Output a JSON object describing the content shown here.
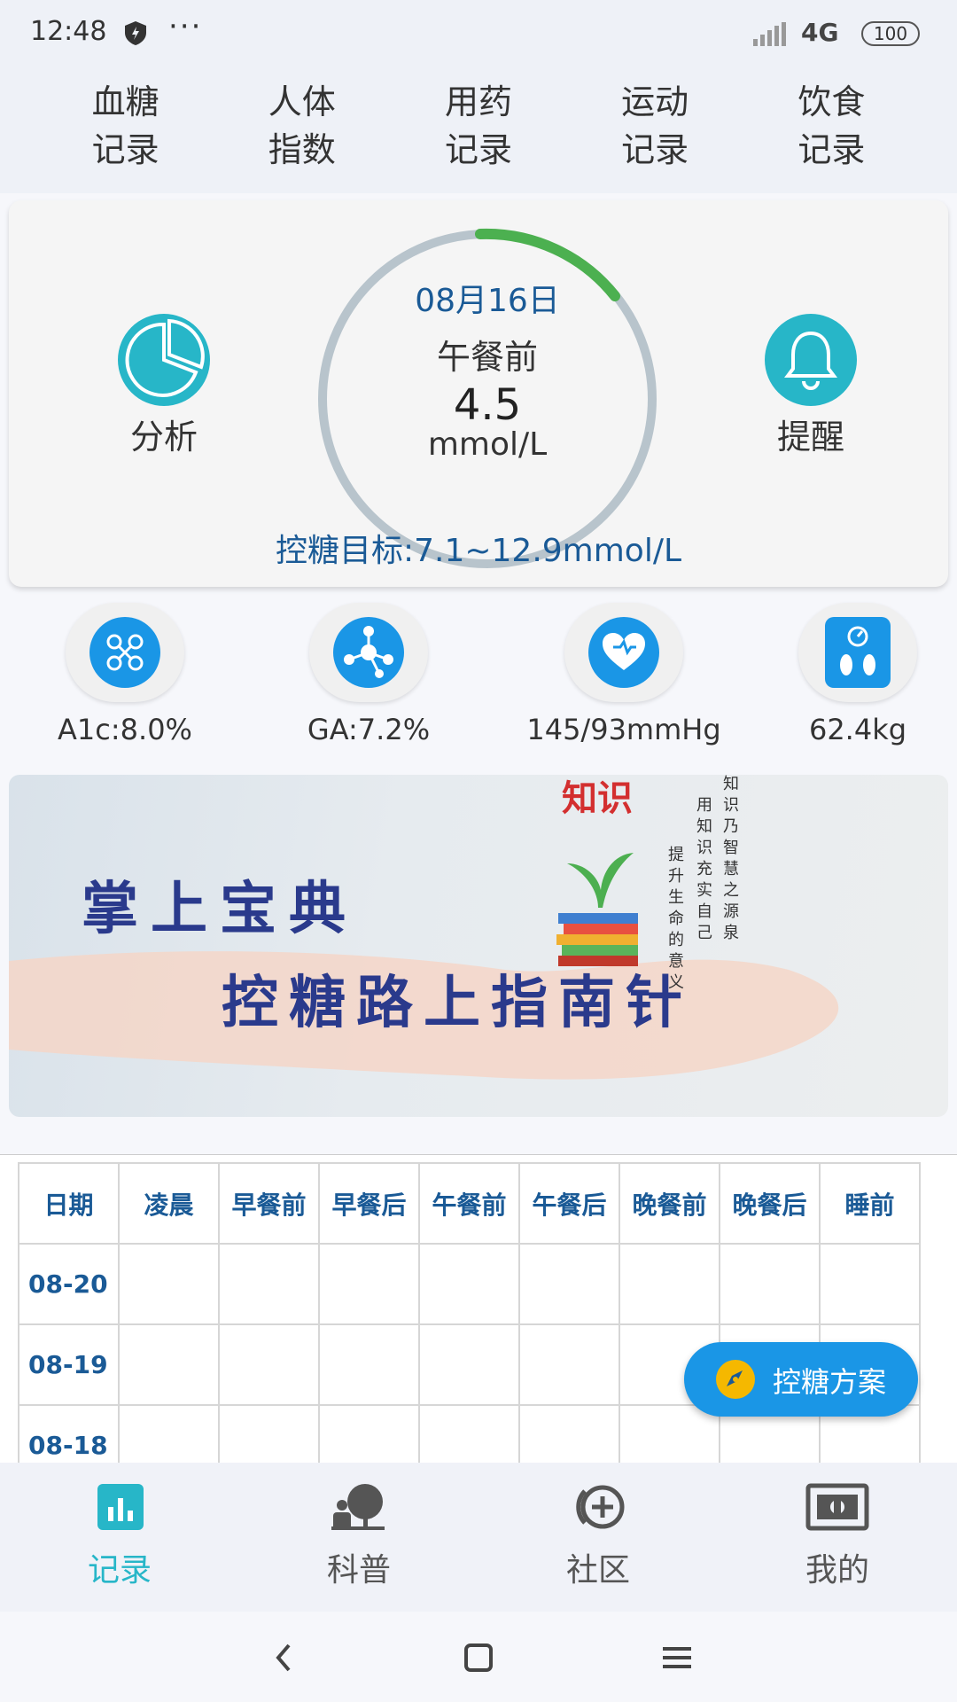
{
  "status_bar": {
    "time": "12:48",
    "dots": "···",
    "network": "4G",
    "battery": "100"
  },
  "top_nav": [
    {
      "label": "血糖\n记录"
    },
    {
      "label": "人体\n指数"
    },
    {
      "label": "用药\n记录"
    },
    {
      "label": "运动\n记录"
    },
    {
      "label": "饮食\n记录"
    }
  ],
  "glucose_card": {
    "analysis_label": "分析",
    "reminder_label": "提醒",
    "date": "08月16日",
    "meal": "午餐前",
    "value": "4.5",
    "unit": "mmol/L",
    "target": "控糖目标:7.1~12.9mmol/L",
    "ring_color": "#b8c4cc",
    "ring_progress_color": "#4cb050"
  },
  "metrics": [
    {
      "label": "A1c:8.0%",
      "icon": "molecule-link-icon"
    },
    {
      "label": "GA:7.2%",
      "icon": "molecule-node-icon"
    },
    {
      "label": "145/93mmHg",
      "icon": "heart-stethoscope-icon"
    },
    {
      "label": "62.4kg",
      "icon": "scale-icon"
    }
  ],
  "banner": {
    "line1": "掌上宝典",
    "line2": "控糖路上指南针",
    "logo": "知识",
    "quote_col1": "知识乃智慧之源泉",
    "quote_col2": "用知识充实自己",
    "quote_col3": "提升生命的意义"
  },
  "table": {
    "headers": [
      "日期",
      "凌晨",
      "早餐前",
      "早餐后",
      "午餐前",
      "午餐后",
      "晚餐前",
      "晚餐后",
      "睡前"
    ],
    "dates": [
      "08-20",
      "08-19",
      "08-18"
    ]
  },
  "fab": {
    "label": "控糖方案"
  },
  "tabbar": [
    {
      "label": "记录"
    },
    {
      "label": "科普"
    },
    {
      "label": "社区"
    },
    {
      "label": "我的"
    }
  ],
  "colors": {
    "accent": "#27b6c8",
    "primary_blue": "#1a96e6",
    "text_blue": "#1a5a96"
  }
}
